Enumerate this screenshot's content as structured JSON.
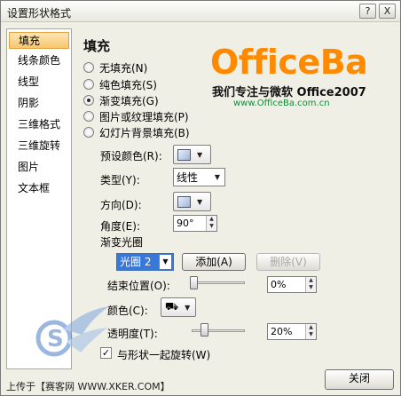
{
  "window": {
    "title": "设置形状格式",
    "help_button": "?",
    "close_button": "X"
  },
  "nav": {
    "items": [
      {
        "label": "填充",
        "active": true
      },
      {
        "label": "线条颜色",
        "active": false
      },
      {
        "label": "线型",
        "active": false
      },
      {
        "label": "阴影",
        "active": false
      },
      {
        "label": "三维格式",
        "active": false
      },
      {
        "label": "三维旋转",
        "active": false
      },
      {
        "label": "图片",
        "active": false
      },
      {
        "label": "文本框",
        "active": false
      }
    ]
  },
  "panel": {
    "title": "填充",
    "radio_options": [
      {
        "label": "无填充(N)",
        "checked": false
      },
      {
        "label": "纯色填充(S)",
        "checked": false
      },
      {
        "label": "渐变填充(G)",
        "checked": true
      },
      {
        "label": "图片或纹理填充(P)",
        "checked": false
      },
      {
        "label": "幻灯片背景填充(B)",
        "checked": false
      }
    ],
    "preset_color_label": "预设颜色(R):",
    "type_label": "类型(Y):",
    "type_value": "线性",
    "direction_label": "方向(D):",
    "angle_label": "角度(E):",
    "angle_value": "90°",
    "gradient_stops_label": "渐变光圈",
    "stop_select_value": "光圈 2",
    "add_button": "添加(A)",
    "remove_button": "删除(V)",
    "end_position_label": "结束位置(O):",
    "end_position_value": "0%",
    "end_position_fraction": 0.0,
    "color_label": "颜色(C):",
    "transparency_label": "透明度(T):",
    "transparency_value": "20%",
    "transparency_fraction": 0.2,
    "rotate_with_shape_label": "与形状一起旋转(W)",
    "rotate_with_shape_checked": true,
    "close_button": "关闭"
  },
  "logo": {
    "brand": "OfficeBa",
    "tagline": "我们专注与微软 Office2007",
    "url": "www.OfficeBa.com.cn"
  },
  "watermark": {
    "bottom_text": "上传于【赛客网 WWW.XKER.COM】"
  },
  "colors": {
    "accent_orange": "#ff8a00",
    "selection_blue": "#3a78d8",
    "url_green": "#118a3a"
  }
}
